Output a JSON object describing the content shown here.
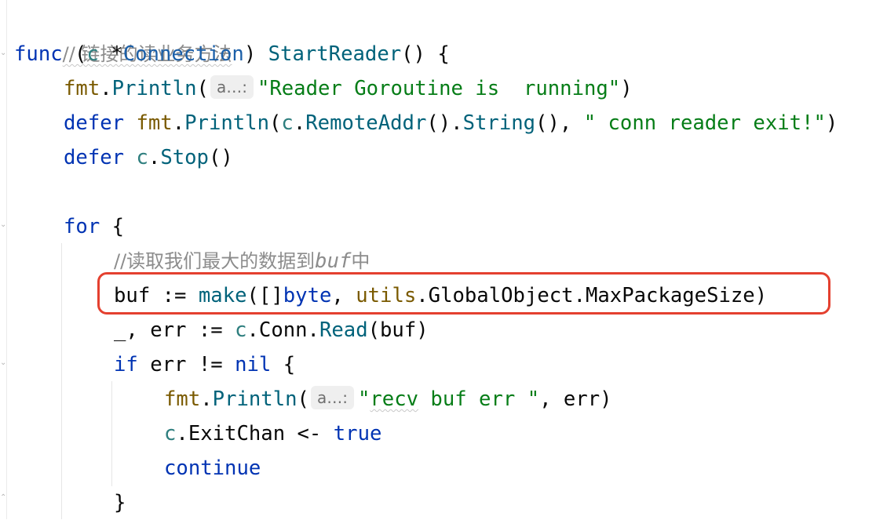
{
  "editor": {
    "comment_header": "// 链接的读业务方法",
    "func_decl": {
      "keyword": "func",
      "open_paren": " (",
      "receiver": "c",
      "star": " *",
      "type": "Connection",
      "close_paren": ") ",
      "name": "StartReader",
      "rest": "() {"
    },
    "println_line": {
      "pkg": "fmt",
      "dot": ".",
      "fn": "Println",
      "open": "(",
      "hint": "a…:",
      "string": "\"Reader Goroutine is  running\"",
      "close": ")"
    },
    "defer_println_line": {
      "keyword": "defer",
      "pkg": "fmt",
      "dot": ".",
      "fn": "Println",
      "open": "(",
      "recv": "c",
      "dot2": ".",
      "method1": "RemoteAddr",
      "mid": "().",
      "method2": "String",
      "after": "(), ",
      "string": "\" conn reader exit!\"",
      "close": ")"
    },
    "defer_stop_line": {
      "keyword": "defer",
      "recv": "c",
      "dot": ".",
      "method": "Stop",
      "rest": "()"
    },
    "for_line": {
      "keyword": "for",
      "rest": " {"
    },
    "comment_read": {
      "prefix": "//读取我们最大的数据到",
      "italic": "buf",
      "suffix": "中"
    },
    "buf_line": {
      "var": "buf := ",
      "fn": "make",
      "open": "([]",
      "type": "byte",
      "comma": ", ",
      "pkg": "utils",
      "rest": ".GlobalObject.MaxPackageSize)"
    },
    "read_line": {
      "lhs": "_, err := ",
      "recv": "c",
      "mid": ".Conn.",
      "method": "Read",
      "rest": "(buf)"
    },
    "if_line": {
      "keyword": "if",
      "mid": " err != ",
      "nil": "nil",
      "rest": " {"
    },
    "recv_err_line": {
      "pkg": "fmt",
      "dot": ".",
      "fn": "Println",
      "open": "(",
      "hint": "a…:",
      "string_open": "\"",
      "string_squiggle": "recv",
      "string_rest": " buf err \"",
      "rest": ", err)"
    },
    "exit_line": {
      "recv": "c",
      "mid": ".ExitChan <- ",
      "value": "true"
    },
    "continue_line": {
      "keyword": "continue"
    },
    "close_brace": "}"
  },
  "colors": {
    "keyword": "#0033b3",
    "package": "#7a5a00",
    "function": "#00627a",
    "string": "#067d17",
    "comment": "#8c8c8c",
    "highlight_box": "#e4402f"
  }
}
